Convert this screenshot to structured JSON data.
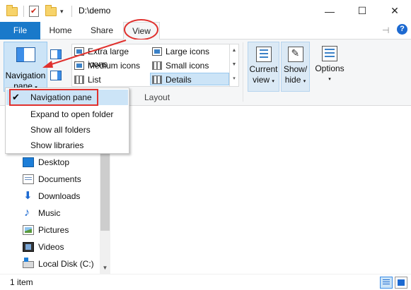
{
  "window": {
    "title": "D:\\demo",
    "minimize": "—",
    "maximize": "☐",
    "close": "✕"
  },
  "tabs": {
    "file": "File",
    "home": "Home",
    "share": "Share",
    "view": "View"
  },
  "ribbon": {
    "navigation_pane": {
      "line1": "Navigation",
      "line2": "pane"
    },
    "layout_items": [
      {
        "label": "Extra large icons",
        "icon": "extra-large-icons-icon"
      },
      {
        "label": "Large icons",
        "icon": "large-icons-icon"
      },
      {
        "label": "Medium icons",
        "icon": "medium-icons-icon"
      },
      {
        "label": "Small icons",
        "icon": "small-icons-icon"
      },
      {
        "label": "List",
        "icon": "list-icon"
      },
      {
        "label": "Details",
        "icon": "details-icon",
        "selected": true
      }
    ],
    "layout_group_label": "Layout",
    "current_view": {
      "line1": "Current",
      "line2": "view"
    },
    "show_hide": {
      "line1": "Show/",
      "line2": "hide"
    },
    "options": {
      "label": "Options"
    }
  },
  "dropdown_menu": {
    "items": [
      {
        "label": "Navigation pane",
        "checked": true
      },
      {
        "label": "Expand to open folder",
        "checked": false
      },
      {
        "label": "Show all folders",
        "checked": false
      },
      {
        "label": "Show libraries",
        "checked": false
      }
    ]
  },
  "nav_pane": {
    "items": [
      {
        "label": "Desktop",
        "icon": "desktop-icon"
      },
      {
        "label": "Documents",
        "icon": "documents-icon"
      },
      {
        "label": "Downloads",
        "icon": "downloads-icon"
      },
      {
        "label": "Music",
        "icon": "music-icon"
      },
      {
        "label": "Pictures",
        "icon": "pictures-icon"
      },
      {
        "label": "Videos",
        "icon": "videos-icon"
      },
      {
        "label": "Local Disk (C:)",
        "icon": "local-disk-icon"
      }
    ]
  },
  "status_bar": {
    "item_count": "1 item"
  },
  "colors": {
    "file_tab": "#1979ca",
    "selection": "#cce4f7",
    "annotation_red": "#e0312e"
  }
}
